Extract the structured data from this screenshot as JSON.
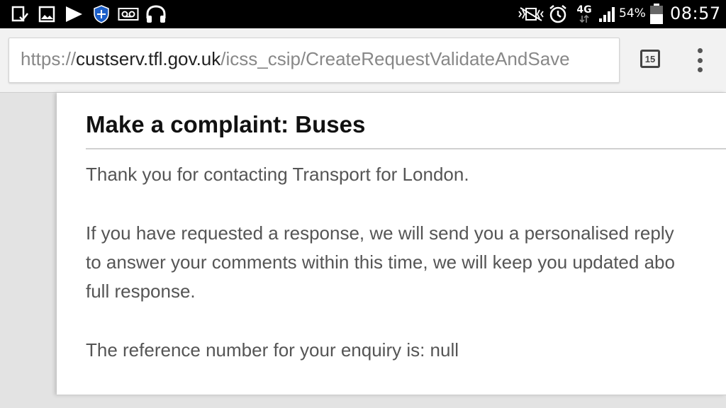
{
  "status_bar": {
    "icons": [
      "screenshot-icon",
      "image-icon",
      "play-icon",
      "shield-icon",
      "voicemail-icon",
      "headphones-icon",
      "vibrate-icon",
      "alarm-icon",
      "network-4g-icon",
      "signal-icon",
      "battery-icon"
    ],
    "network": "4G",
    "battery": "54%",
    "battery_level": 54,
    "time": "08:57"
  },
  "browser": {
    "url_scheme": "https://",
    "url_host": "custserv.tfl.gov.uk",
    "url_path": "/icss_csip/CreateRequestValidateAndSave",
    "tab_count": "15"
  },
  "page": {
    "title": "Make a complaint: Buses",
    "paragraphs": [
      "Thank you for contacting Transport for London.",
      "If you have requested a response, we will send you a personalised reply",
      "to answer your comments within this time, we will keep you updated abo",
      "full response.",
      "The reference number for your enquiry is: null"
    ]
  }
}
